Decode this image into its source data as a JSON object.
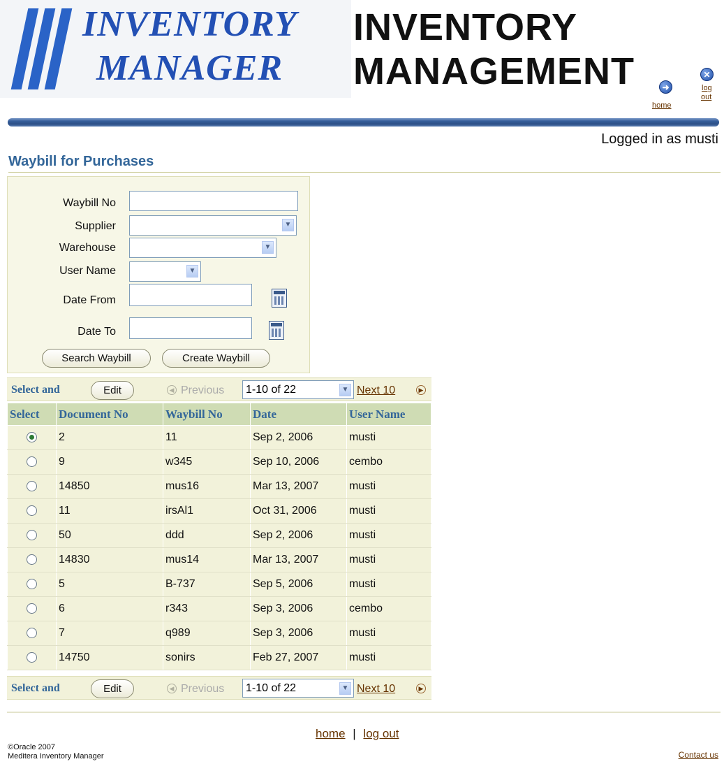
{
  "header": {
    "logo_line1": "INVENTORY",
    "logo_line2": "MANAGER",
    "title_line1": "INVENTORY",
    "title_line2": "MANAGEMENT",
    "home_label": "home",
    "logout_label1": "log",
    "logout_label2": "out",
    "logged_in": "Logged in as musti",
    "icons": {
      "home": "home-icon",
      "logout": "logout-icon"
    }
  },
  "page_title": "Waybill for Purchases",
  "search": {
    "waybill_no_label": "Waybill No",
    "waybill_no_value": "",
    "supplier_label": "Supplier",
    "supplier_value": "",
    "warehouse_label": "Warehouse",
    "warehouse_value": "",
    "user_name_label": "User Name",
    "user_name_value": "",
    "date_from_label": "Date From",
    "date_from_value": "",
    "date_to_label": "Date To",
    "date_to_value": "",
    "search_button": "Search Waybill",
    "create_button": "Create Waybill"
  },
  "table_controls": {
    "select_and": "Select and",
    "edit_button": "Edit",
    "previous": "Previous",
    "range": "1-10 of 22",
    "next": "Next 10"
  },
  "table": {
    "columns": [
      "Select",
      "Document No",
      "Waybill No",
      "Date",
      "User Name"
    ],
    "rows": [
      {
        "selected": true,
        "document_no": "2",
        "waybill_no": "11",
        "date": "Sep 2, 2006",
        "user": "musti"
      },
      {
        "selected": false,
        "document_no": "9",
        "waybill_no": "w345",
        "date": "Sep 10, 2006",
        "user": "cembo"
      },
      {
        "selected": false,
        "document_no": "14850",
        "waybill_no": "mus16",
        "date": "Mar 13, 2007",
        "user": "musti"
      },
      {
        "selected": false,
        "document_no": "11",
        "waybill_no": "irsAl1",
        "date": "Oct 31, 2006",
        "user": "musti"
      },
      {
        "selected": false,
        "document_no": "50",
        "waybill_no": "ddd",
        "date": "Sep 2, 2006",
        "user": "musti"
      },
      {
        "selected": false,
        "document_no": "14830",
        "waybill_no": "mus14",
        "date": "Mar 13, 2007",
        "user": "musti"
      },
      {
        "selected": false,
        "document_no": "5",
        "waybill_no": "B-737",
        "date": "Sep 5, 2006",
        "user": "musti"
      },
      {
        "selected": false,
        "document_no": "6",
        "waybill_no": "r343",
        "date": "Sep 3, 2006",
        "user": "cembo"
      },
      {
        "selected": false,
        "document_no": "7",
        "waybill_no": "q989",
        "date": "Sep 3, 2006",
        "user": "musti"
      },
      {
        "selected": false,
        "document_no": "14750",
        "waybill_no": "sonirs",
        "date": "Feb 27, 2007",
        "user": "musti"
      }
    ]
  },
  "footer": {
    "home": "home",
    "separator": "|",
    "logout": "log out",
    "copyright": "©Oracle 2007",
    "product": "Meditera Inventory Manager",
    "contact": "Contact us"
  }
}
